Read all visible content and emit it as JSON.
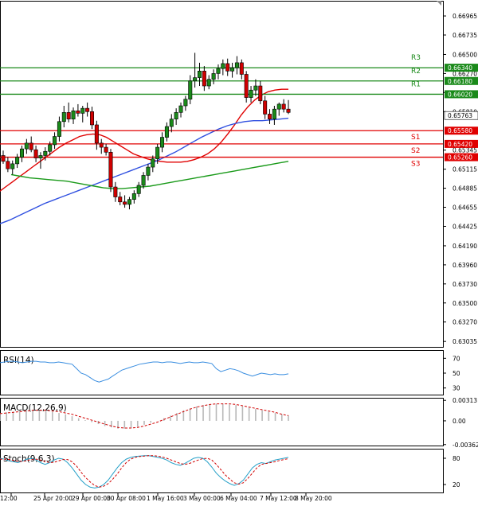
{
  "chart_data": {
    "type": "candlestick",
    "price_axis": {
      "ticks": [
        "0.66965",
        "0.66735",
        "0.66500",
        "0.66270",
        "0.66040",
        "0.65810",
        "0.65345",
        "0.65115",
        "0.64885",
        "0.64655",
        "0.64425",
        "0.64190",
        "0.63960",
        "0.63730",
        "0.63500",
        "0.63270",
        "0.63035"
      ],
      "range": [
        0.6296,
        0.671
      ]
    },
    "levels": [
      {
        "name": "R3",
        "value": 0.6634,
        "label": "0.66340",
        "color": "#1a8a1a"
      },
      {
        "name": "R2",
        "value": 0.6618,
        "label": "0.66180",
        "color": "#1a8a1a"
      },
      {
        "name": "R1",
        "value": 0.6602,
        "label": "0.66020",
        "color": "#1a8a1a"
      },
      {
        "name": "S1",
        "value": 0.6558,
        "label": "0.65580",
        "color": "#e00000"
      },
      {
        "name": "S2",
        "value": 0.6542,
        "label": "0.65420",
        "color": "#e00000"
      },
      {
        "name": "S3",
        "value": 0.6526,
        "label": "0.65260",
        "color": "#e00000"
      }
    ],
    "current_price": {
      "value": 0.65763,
      "label": "0.65763"
    },
    "candles_ohlc": [
      [
        0.6528,
        0.6534,
        0.6518,
        0.6521
      ],
      [
        0.6521,
        0.6526,
        0.6508,
        0.6512
      ],
      [
        0.6512,
        0.6522,
        0.6505,
        0.6518
      ],
      [
        0.6518,
        0.653,
        0.6513,
        0.6526
      ],
      [
        0.6526,
        0.654,
        0.652,
        0.6536
      ],
      [
        0.6536,
        0.6548,
        0.653,
        0.6543
      ],
      [
        0.6543,
        0.6551,
        0.6532,
        0.6535
      ],
      [
        0.6535,
        0.654,
        0.652,
        0.6525
      ],
      [
        0.6525,
        0.6532,
        0.6512,
        0.6528
      ],
      [
        0.6528,
        0.6538,
        0.6522,
        0.6533
      ],
      [
        0.6533,
        0.6545,
        0.6528,
        0.6541
      ],
      [
        0.6541,
        0.6556,
        0.6536,
        0.6551
      ],
      [
        0.6551,
        0.6575,
        0.6545,
        0.6569
      ],
      [
        0.6569,
        0.6588,
        0.6562,
        0.658
      ],
      [
        0.658,
        0.6592,
        0.6568,
        0.6572
      ],
      [
        0.6572,
        0.6586,
        0.6566,
        0.6582
      ],
      [
        0.6582,
        0.659,
        0.6575,
        0.6579
      ],
      [
        0.6579,
        0.6588,
        0.6568,
        0.6585
      ],
      [
        0.6585,
        0.6592,
        0.6575,
        0.6581
      ],
      [
        0.6581,
        0.6587,
        0.656,
        0.6565
      ],
      [
        0.6565,
        0.657,
        0.6535,
        0.6543
      ],
      [
        0.6543,
        0.6548,
        0.653,
        0.6538
      ],
      [
        0.6538,
        0.6542,
        0.6528,
        0.6532
      ],
      [
        0.6532,
        0.6536,
        0.6484,
        0.649
      ],
      [
        0.649,
        0.6496,
        0.6472,
        0.6478
      ],
      [
        0.6478,
        0.6484,
        0.6468,
        0.6472
      ],
      [
        0.6472,
        0.648,
        0.6465,
        0.6469
      ],
      [
        0.6469,
        0.6478,
        0.6463,
        0.6475
      ],
      [
        0.6475,
        0.6486,
        0.647,
        0.6482
      ],
      [
        0.6482,
        0.6496,
        0.6478,
        0.6492
      ],
      [
        0.6492,
        0.6508,
        0.6488,
        0.6504
      ],
      [
        0.6504,
        0.6518,
        0.6498,
        0.6514
      ],
      [
        0.6514,
        0.6528,
        0.6508,
        0.6524
      ],
      [
        0.6524,
        0.6542,
        0.6518,
        0.6538
      ],
      [
        0.6538,
        0.6556,
        0.6532,
        0.655
      ],
      [
        0.655,
        0.6568,
        0.6545,
        0.6563
      ],
      [
        0.6563,
        0.6578,
        0.6556,
        0.6572
      ],
      [
        0.6572,
        0.6585,
        0.6565,
        0.658
      ],
      [
        0.658,
        0.6592,
        0.6574,
        0.6588
      ],
      [
        0.6588,
        0.66,
        0.6582,
        0.6596
      ],
      [
        0.6596,
        0.6625,
        0.659,
        0.6618
      ],
      [
        0.6618,
        0.6652,
        0.661,
        0.6622
      ],
      [
        0.6622,
        0.664,
        0.6612,
        0.663
      ],
      [
        0.663,
        0.6636,
        0.6606,
        0.6612
      ],
      [
        0.6612,
        0.6625,
        0.6608,
        0.662
      ],
      [
        0.662,
        0.6632,
        0.6614,
        0.6627
      ],
      [
        0.6627,
        0.6638,
        0.662,
        0.6633
      ],
      [
        0.6633,
        0.6644,
        0.6625,
        0.6639
      ],
      [
        0.6639,
        0.6645,
        0.6624,
        0.663
      ],
      [
        0.663,
        0.664,
        0.6622,
        0.6634
      ],
      [
        0.6634,
        0.6648,
        0.6626,
        0.664
      ],
      [
        0.664,
        0.6644,
        0.662,
        0.6626
      ],
      [
        0.6626,
        0.663,
        0.6592,
        0.6598
      ],
      [
        0.6598,
        0.6612,
        0.6592,
        0.6607
      ],
      [
        0.6607,
        0.662,
        0.66,
        0.6612
      ],
      [
        0.6612,
        0.6618,
        0.659,
        0.6594
      ],
      [
        0.6594,
        0.66,
        0.6572,
        0.6578
      ],
      [
        0.6578,
        0.6584,
        0.6566,
        0.6572
      ],
      [
        0.6572,
        0.6588,
        0.6565,
        0.6584
      ],
      [
        0.6584,
        0.6592,
        0.6576,
        0.659
      ],
      [
        0.659,
        0.6596,
        0.658,
        0.6584
      ],
      [
        0.6584,
        0.6595,
        0.6578,
        0.658
      ]
    ],
    "moving_averages": [
      {
        "color": "#e00000",
        "values": [
          0.6478,
          0.6484,
          0.649,
          0.6496,
          0.6502,
          0.6508,
          0.6514,
          0.652,
          0.6526,
          0.6532,
          0.6538,
          0.6543,
          0.6547,
          0.6551,
          0.6553,
          0.6554,
          0.6553,
          0.655,
          0.6545,
          0.654,
          0.6535,
          0.653,
          0.6527,
          0.6524,
          0.6522,
          0.6521,
          0.652,
          0.652,
          0.652,
          0.6521,
          0.6523,
          0.6526,
          0.653,
          0.6536,
          0.6544,
          0.6554,
          0.6565,
          0.6577,
          0.6587,
          0.6595,
          0.6601,
          0.6605,
          0.6607,
          0.6608,
          0.6608
        ]
      },
      {
        "color": "#3050e0",
        "values": [
          0.6443,
          0.6446,
          0.645,
          0.6455,
          0.646,
          0.6465,
          0.647,
          0.6474,
          0.6478,
          0.6482,
          0.6486,
          0.649,
          0.6494,
          0.6498,
          0.6502,
          0.6506,
          0.651,
          0.6514,
          0.6518,
          0.6522,
          0.6527,
          0.6532,
          0.6538,
          0.6544,
          0.655,
          0.6555,
          0.656,
          0.6564,
          0.6567,
          0.6569,
          0.657,
          0.657,
          0.6571,
          0.6572,
          0.6573
        ]
      },
      {
        "color": "#1a9a1a",
        "values": [
          0.6505,
          0.6503,
          0.6501,
          0.65,
          0.6499,
          0.6498,
          0.6497,
          0.6495,
          0.6493,
          0.6491,
          0.6489,
          0.6488,
          0.6488,
          0.6489,
          0.649,
          0.6491,
          0.6493,
          0.6495,
          0.6497,
          0.6499,
          0.6501,
          0.6503,
          0.6505,
          0.6507,
          0.6509,
          0.6511,
          0.6513,
          0.6515,
          0.6517,
          0.6519,
          0.6521
        ]
      }
    ],
    "x_labels": [
      "12:00",
      "25 Apr 20:00",
      "29 Apr 00:00",
      "30 Apr 08:00",
      "1 May 16:00",
      "3 May 00:00",
      "6 May 04:00",
      "7 May 12:00",
      "8 May 20:00"
    ],
    "indicators": [
      {
        "name": "RSI(14)",
        "ticks": [
          "70",
          "50",
          "30"
        ],
        "range": [
          20,
          80
        ],
        "values": [
          64,
          65,
          66,
          66,
          65,
          64,
          65,
          66,
          66,
          65,
          65,
          64,
          64,
          65,
          64,
          63,
          62,
          56,
          50,
          48,
          44,
          40,
          38,
          40,
          42,
          46,
          50,
          54,
          56,
          58,
          60,
          62,
          63,
          64,
          65,
          65,
          64,
          65,
          65,
          64,
          63,
          64,
          65,
          64,
          64,
          65,
          64,
          63,
          56,
          52,
          54,
          56,
          55,
          53,
          50,
          48,
          46,
          48,
          50,
          49,
          48,
          49,
          48,
          48,
          49
        ]
      },
      {
        "name": "MACD(12,26,9)",
        "ticks": [
          "0.00313",
          "0.00",
          "-0.003627"
        ],
        "range": [
          -0.0039,
          0.0034
        ],
        "histogram": [
          0.0012,
          0.0013,
          0.0014,
          0.0015,
          0.0016,
          0.0016,
          0.0016,
          0.0015,
          0.0014,
          0.0012,
          0.001,
          0.0007,
          0.0004,
          0.0001,
          -0.0002,
          -0.0005,
          -0.0008,
          -0.001,
          -0.0012,
          -0.0012,
          -0.0011,
          -0.0009,
          -0.0006,
          -0.0003,
          0.0,
          0.0004,
          0.0008,
          0.0012,
          0.0016,
          0.0019,
          0.0022,
          0.0024,
          0.0025,
          0.0026,
          0.0026,
          0.0025,
          0.0024,
          0.0022,
          0.002,
          0.0018,
          0.0016,
          0.0014,
          0.0012,
          0.001,
          0.0008
        ],
        "signal": [
          0.0011,
          0.0012,
          0.0013,
          0.0014,
          0.0015,
          0.0016,
          0.0016,
          0.0016,
          0.0015,
          0.0014,
          0.0012,
          0.001,
          0.0007,
          0.0004,
          0.0001,
          -0.0002,
          -0.0005,
          -0.0008,
          -0.001,
          -0.0011,
          -0.0011,
          -0.001,
          -0.0008,
          -0.0005,
          -0.0002,
          0.0002,
          0.0006,
          0.001,
          0.0014,
          0.0018,
          0.0021,
          0.0023,
          0.0025,
          0.0026,
          0.0026,
          0.0026,
          0.0025,
          0.0023,
          0.0021,
          0.0019,
          0.0017,
          0.0015,
          0.0013,
          0.001,
          0.0008
        ]
      },
      {
        "name": "Stoch(9,6,3)",
        "ticks": [
          "80",
          "20"
        ],
        "range": [
          0,
          100
        ],
        "k": [
          80,
          78,
          74,
          72,
          70,
          74,
          78,
          80,
          76,
          70,
          66,
          70,
          76,
          80,
          78,
          70,
          58,
          44,
          30,
          20,
          14,
          12,
          14,
          20,
          30,
          44,
          58,
          70,
          78,
          82,
          84,
          85,
          86,
          86,
          84,
          82,
          80,
          76,
          70,
          66,
          64,
          68,
          74,
          80,
          82,
          80,
          72,
          60,
          46,
          36,
          28,
          22,
          18,
          22,
          30,
          44,
          58,
          66,
          70,
          68,
          72,
          76,
          78,
          80,
          82
        ],
        "d": [
          78,
          78,
          77,
          75,
          73,
          73,
          75,
          77,
          78,
          76,
          73,
          70,
          71,
          74,
          77,
          77,
          72,
          62,
          48,
          36,
          26,
          18,
          14,
          16,
          22,
          32,
          44,
          58,
          70,
          78,
          82,
          84,
          85,
          86,
          86,
          85,
          83,
          80,
          76,
          72,
          68,
          66,
          68,
          72,
          76,
          79,
          80,
          76,
          66,
          54,
          42,
          32,
          24,
          21,
          24,
          34,
          46,
          58,
          66,
          68,
          70,
          72,
          75,
          77,
          79
        ]
      }
    ]
  }
}
